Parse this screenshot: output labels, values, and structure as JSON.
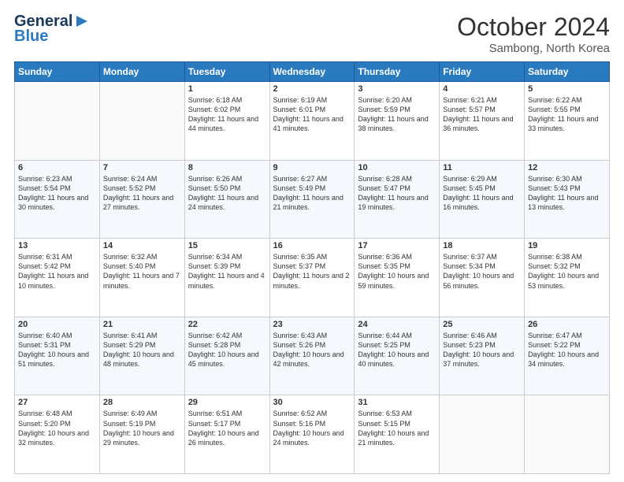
{
  "header": {
    "logo_line1": "General",
    "logo_line2": "Blue",
    "month": "October 2024",
    "location": "Sambong, North Korea"
  },
  "weekdays": [
    "Sunday",
    "Monday",
    "Tuesday",
    "Wednesday",
    "Thursday",
    "Friday",
    "Saturday"
  ],
  "rows": [
    [
      {
        "day": "",
        "content": ""
      },
      {
        "day": "",
        "content": ""
      },
      {
        "day": "1",
        "content": "Sunrise: 6:18 AM\nSunset: 6:02 PM\nDaylight: 11 hours and 44 minutes."
      },
      {
        "day": "2",
        "content": "Sunrise: 6:19 AM\nSunset: 6:01 PM\nDaylight: 11 hours and 41 minutes."
      },
      {
        "day": "3",
        "content": "Sunrise: 6:20 AM\nSunset: 5:59 PM\nDaylight: 11 hours and 38 minutes."
      },
      {
        "day": "4",
        "content": "Sunrise: 6:21 AM\nSunset: 5:57 PM\nDaylight: 11 hours and 36 minutes."
      },
      {
        "day": "5",
        "content": "Sunrise: 6:22 AM\nSunset: 5:55 PM\nDaylight: 11 hours and 33 minutes."
      }
    ],
    [
      {
        "day": "6",
        "content": "Sunrise: 6:23 AM\nSunset: 5:54 PM\nDaylight: 11 hours and 30 minutes."
      },
      {
        "day": "7",
        "content": "Sunrise: 6:24 AM\nSunset: 5:52 PM\nDaylight: 11 hours and 27 minutes."
      },
      {
        "day": "8",
        "content": "Sunrise: 6:26 AM\nSunset: 5:50 PM\nDaylight: 11 hours and 24 minutes."
      },
      {
        "day": "9",
        "content": "Sunrise: 6:27 AM\nSunset: 5:49 PM\nDaylight: 11 hours and 21 minutes."
      },
      {
        "day": "10",
        "content": "Sunrise: 6:28 AM\nSunset: 5:47 PM\nDaylight: 11 hours and 19 minutes."
      },
      {
        "day": "11",
        "content": "Sunrise: 6:29 AM\nSunset: 5:45 PM\nDaylight: 11 hours and 16 minutes."
      },
      {
        "day": "12",
        "content": "Sunrise: 6:30 AM\nSunset: 5:43 PM\nDaylight: 11 hours and 13 minutes."
      }
    ],
    [
      {
        "day": "13",
        "content": "Sunrise: 6:31 AM\nSunset: 5:42 PM\nDaylight: 11 hours and 10 minutes."
      },
      {
        "day": "14",
        "content": "Sunrise: 6:32 AM\nSunset: 5:40 PM\nDaylight: 11 hours and 7 minutes."
      },
      {
        "day": "15",
        "content": "Sunrise: 6:34 AM\nSunset: 5:39 PM\nDaylight: 11 hours and 4 minutes."
      },
      {
        "day": "16",
        "content": "Sunrise: 6:35 AM\nSunset: 5:37 PM\nDaylight: 11 hours and 2 minutes."
      },
      {
        "day": "17",
        "content": "Sunrise: 6:36 AM\nSunset: 5:35 PM\nDaylight: 10 hours and 59 minutes."
      },
      {
        "day": "18",
        "content": "Sunrise: 6:37 AM\nSunset: 5:34 PM\nDaylight: 10 hours and 56 minutes."
      },
      {
        "day": "19",
        "content": "Sunrise: 6:38 AM\nSunset: 5:32 PM\nDaylight: 10 hours and 53 minutes."
      }
    ],
    [
      {
        "day": "20",
        "content": "Sunrise: 6:40 AM\nSunset: 5:31 PM\nDaylight: 10 hours and 51 minutes."
      },
      {
        "day": "21",
        "content": "Sunrise: 6:41 AM\nSunset: 5:29 PM\nDaylight: 10 hours and 48 minutes."
      },
      {
        "day": "22",
        "content": "Sunrise: 6:42 AM\nSunset: 5:28 PM\nDaylight: 10 hours and 45 minutes."
      },
      {
        "day": "23",
        "content": "Sunrise: 6:43 AM\nSunset: 5:26 PM\nDaylight: 10 hours and 42 minutes."
      },
      {
        "day": "24",
        "content": "Sunrise: 6:44 AM\nSunset: 5:25 PM\nDaylight: 10 hours and 40 minutes."
      },
      {
        "day": "25",
        "content": "Sunrise: 6:46 AM\nSunset: 5:23 PM\nDaylight: 10 hours and 37 minutes."
      },
      {
        "day": "26",
        "content": "Sunrise: 6:47 AM\nSunset: 5:22 PM\nDaylight: 10 hours and 34 minutes."
      }
    ],
    [
      {
        "day": "27",
        "content": "Sunrise: 6:48 AM\nSunset: 5:20 PM\nDaylight: 10 hours and 32 minutes."
      },
      {
        "day": "28",
        "content": "Sunrise: 6:49 AM\nSunset: 5:19 PM\nDaylight: 10 hours and 29 minutes."
      },
      {
        "day": "29",
        "content": "Sunrise: 6:51 AM\nSunset: 5:17 PM\nDaylight: 10 hours and 26 minutes."
      },
      {
        "day": "30",
        "content": "Sunrise: 6:52 AM\nSunset: 5:16 PM\nDaylight: 10 hours and 24 minutes."
      },
      {
        "day": "31",
        "content": "Sunrise: 6:53 AM\nSunset: 5:15 PM\nDaylight: 10 hours and 21 minutes."
      },
      {
        "day": "",
        "content": ""
      },
      {
        "day": "",
        "content": ""
      }
    ]
  ]
}
